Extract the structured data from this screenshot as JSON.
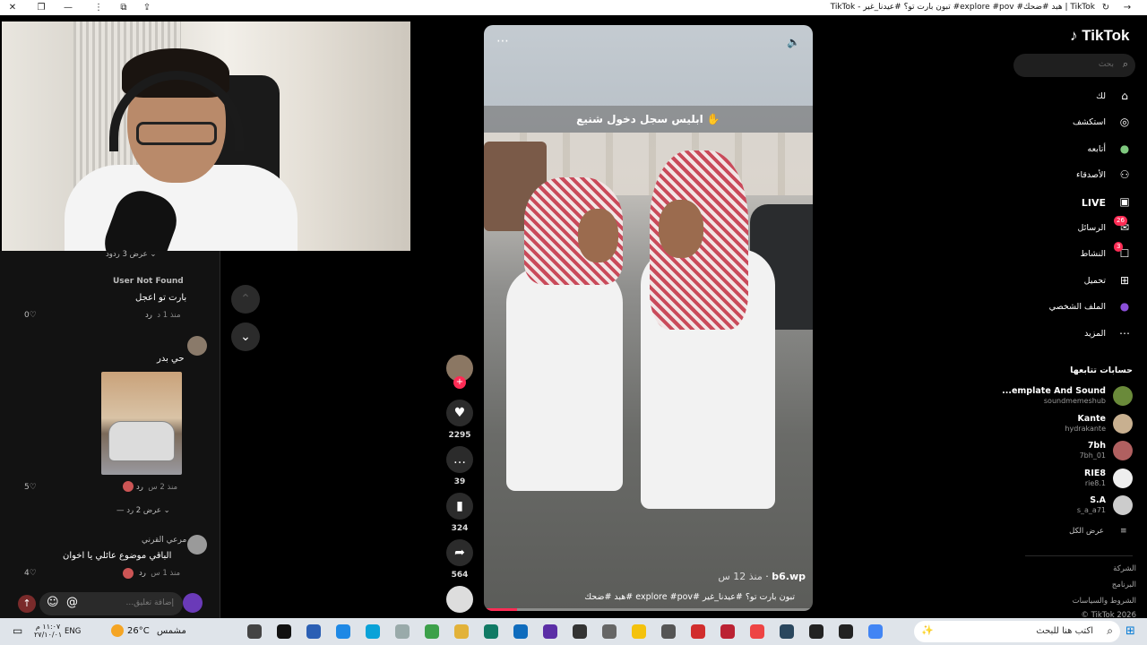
{
  "window": {
    "title": "TikTok | هبد #ضحك# explore #pov# تبون بارت تو؟ #عيدنا_غير - TikTok",
    "minimize": "—",
    "maximize": "❐",
    "close": "✕"
  },
  "comments": {
    "view_replies_top": "عرض 3 ردود",
    "items": [
      {
        "author": "User Not Found",
        "text": "بارت تو اعجل",
        "time": "منذ 1 د",
        "reply": "رد",
        "likes": "0"
      },
      {
        "author": "",
        "text": "حي بدر",
        "time": "منذ 2 س",
        "reply": "رد",
        "likes": "5",
        "view_replies": "عرض 2 رد"
      },
      {
        "author": "مرعي القرني",
        "text": "الباقي موضوع عائلي يا اخوان",
        "time": "منذ 1 س",
        "reply": "رد",
        "likes": "4"
      }
    ],
    "input_placeholder": "إضافة تعليق..."
  },
  "video": {
    "caption_overlay": "ابليس سجل دخول شنيع",
    "author": "b6.wp",
    "posted": "منذ 12 س",
    "description": "تبون بارت تو؟ #عيدنا_غير #explore #pov #هبد #ضحك",
    "progress": 0.1
  },
  "actions": {
    "likes": "2295",
    "comments": "39",
    "saves": "324",
    "shares": "564"
  },
  "sidebar": {
    "logo": "TikTok",
    "search_placeholder": "بحث",
    "nav": [
      {
        "label": "لك",
        "icon": "home-icon"
      },
      {
        "label": "استكشف",
        "icon": "compass-icon"
      },
      {
        "label": "أتابعه",
        "icon": "following-icon"
      },
      {
        "label": "الأصدقاء",
        "icon": "friends-icon"
      },
      {
        "label": "LIVE",
        "icon": "live-icon"
      },
      {
        "label": "الرسائل",
        "icon": "messages-icon",
        "badge": "26"
      },
      {
        "label": "النشاط",
        "icon": "activity-icon",
        "badge": "3"
      },
      {
        "label": "تحميل",
        "icon": "upload-icon"
      },
      {
        "label": "الملف الشخصي",
        "icon": "profile-icon"
      },
      {
        "label": "المزيد",
        "icon": "more-icon"
      }
    ],
    "following_title": "حسابات تتابعها",
    "following": [
      {
        "name": "...emplate And Sound",
        "handle": "soundmemeshub"
      },
      {
        "name": "Kante",
        "handle": "hydrakante"
      },
      {
        "name": "7bh",
        "handle": "7bh_01"
      },
      {
        "name": "RIE8",
        "handle": "rie8.1"
      },
      {
        "name": "S.A",
        "handle": "s_a_a71"
      }
    ],
    "see_all": "عرض الكل",
    "footer": [
      "الشركة",
      "البرنامج",
      "الشروط والسياسات",
      "© TikTok 2026"
    ]
  },
  "taskbar": {
    "search_placeholder": "اكتب هنا للبحث",
    "weather": "26°C",
    "weather_desc": "مشمس",
    "lang": "ENG",
    "time": "١١:٠٧ م",
    "date": "٢٧/١٠/٠١"
  },
  "colors": {
    "accent": "#fe2c55",
    "taskbar": "#dfe4ea"
  }
}
